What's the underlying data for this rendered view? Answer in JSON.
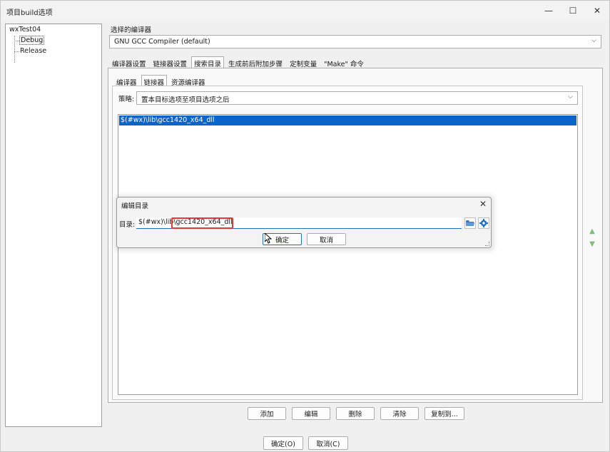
{
  "window": {
    "title": "项目build选项",
    "min": "—",
    "max": "☐",
    "close": "✕"
  },
  "tree": {
    "root": "wxTest04",
    "items": [
      "Debug",
      "Release"
    ]
  },
  "compiler": {
    "label": "选择的编译器",
    "selected": "GNU GCC Compiler (default)"
  },
  "tabs": [
    "编译器设置",
    "链接器设置",
    "搜索目录",
    "生成前后附加步骤",
    "定制变量",
    "\"Make\" 命令"
  ],
  "subtabs": [
    "编译器",
    "链接器",
    "资源编译器"
  ],
  "policy": {
    "label": "策略:",
    "selected": "置本目标选项至项目选项之后"
  },
  "dir_list": [
    "$(#wx)\\lib\\gcc1420_x64_dll"
  ],
  "list_buttons": [
    "添加",
    "编辑",
    "删除",
    "清除",
    "复制到..."
  ],
  "dialog": {
    "title": "编辑目录",
    "label": "目录:",
    "value": "$(#wx)\\lib\\gcc1420_x64_dll",
    "ok": "确定",
    "cancel": "取消"
  },
  "footer": {
    "ok": "确定(O)",
    "cancel": "取消(C)"
  }
}
